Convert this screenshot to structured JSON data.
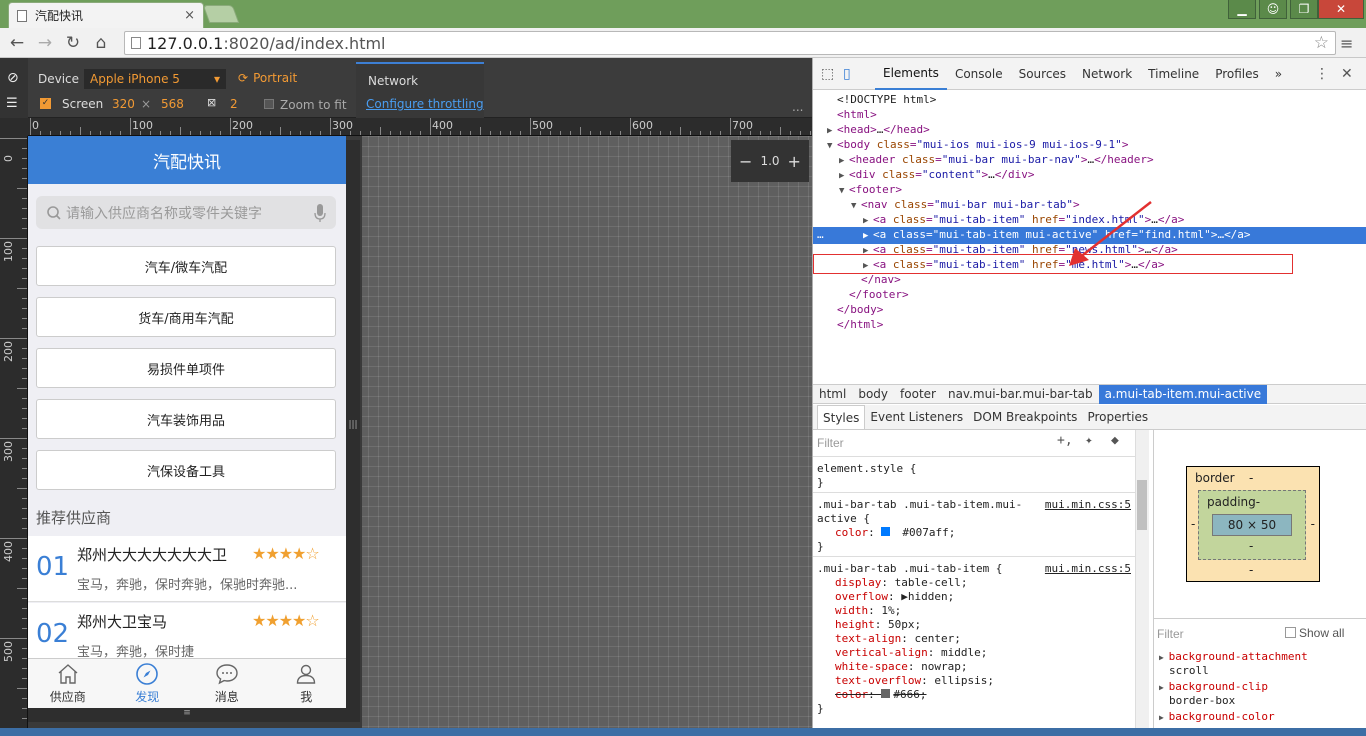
{
  "browser": {
    "tab_title": "汽配快讯",
    "url_host": "127.0.0.1",
    "url_rest": ":8020/ad/index.html"
  },
  "device_bar": {
    "device_label": "Device",
    "device_value": "Apple iPhone 5",
    "orientation": "Portrait",
    "screen_label": "Screen",
    "width": "320",
    "times": "×",
    "height": "568",
    "dpr": "2",
    "zoom_to_fit": "Zoom to fit",
    "network_label": "Network",
    "throttling": "Configure throttling",
    "more": "..."
  },
  "zoom": {
    "minus": "−",
    "value": "1.0",
    "plus": "+"
  },
  "ruler": {
    "h_labels": [
      "0",
      "100",
      "200",
      "300",
      "400",
      "500",
      "600",
      "700"
    ],
    "v_labels": [
      "0",
      "100",
      "200",
      "300",
      "400",
      "500"
    ]
  },
  "app": {
    "title": "汽配快讯",
    "search_placeholder": "请输入供应商名称或零件关键字",
    "categories": [
      "汽车/微车汽配",
      "货车/商用车汽配",
      "易损件单项件",
      "汽车装饰用品",
      "汽保设备工具"
    ],
    "recommend_title": "推荐供应商",
    "suppliers": [
      {
        "num": "01",
        "name": "郑州大大大大大大大卫",
        "stars": "★★★★☆",
        "desc": "宝马，奔驰，保时奔驰，保驰时奔驰..."
      },
      {
        "num": "02",
        "name": "郑州大卫宝马",
        "stars": "★★★★☆",
        "desc": "宝马，奔驰，保时捷"
      }
    ],
    "tabs": [
      {
        "label": "供应商",
        "icon": "home-icon"
      },
      {
        "label": "发现",
        "icon": "compass-icon"
      },
      {
        "label": "消息",
        "icon": "chat-icon"
      },
      {
        "label": "我",
        "icon": "user-icon"
      }
    ]
  },
  "devtools": {
    "tabs": [
      "Elements",
      "Console",
      "Sources",
      "Network",
      "Timeline",
      "Profiles",
      "»"
    ],
    "dom_lines": [
      {
        "indent": 0,
        "tw": "",
        "parts": [
          [
            "tx",
            "<!DOCTYPE html>"
          ]
        ]
      },
      {
        "indent": 0,
        "tw": "",
        "parts": [
          [
            "tg",
            "<html>"
          ]
        ]
      },
      {
        "indent": 0,
        "tw": "▶",
        "parts": [
          [
            "tg",
            "<head>"
          ],
          [
            "tx",
            "…"
          ],
          [
            "tg",
            "</head>"
          ]
        ]
      },
      {
        "indent": 0,
        "tw": "▼",
        "parts": [
          [
            "tg",
            "<body "
          ],
          [
            "at",
            "class"
          ],
          [
            "tg",
            "="
          ],
          [
            "av",
            "\"mui-ios mui-ios-9 mui-ios-9-1\""
          ],
          [
            "tg",
            ">"
          ]
        ]
      },
      {
        "indent": 1,
        "tw": "▶",
        "parts": [
          [
            "tg",
            "<header "
          ],
          [
            "at",
            "class"
          ],
          [
            "tg",
            "="
          ],
          [
            "av",
            "\"mui-bar mui-bar-nav\""
          ],
          [
            "tg",
            ">"
          ],
          [
            "tx",
            "…"
          ],
          [
            "tg",
            "</header>"
          ]
        ]
      },
      {
        "indent": 1,
        "tw": "▶",
        "parts": [
          [
            "tg",
            "<div "
          ],
          [
            "at",
            "class"
          ],
          [
            "tg",
            "="
          ],
          [
            "av",
            "\"content\""
          ],
          [
            "tg",
            ">"
          ],
          [
            "tx",
            "…"
          ],
          [
            "tg",
            "</div>"
          ]
        ]
      },
      {
        "indent": 1,
        "tw": "▼",
        "parts": [
          [
            "tg",
            "<footer>"
          ]
        ]
      },
      {
        "indent": 2,
        "tw": "▼",
        "parts": [
          [
            "tg",
            "<nav "
          ],
          [
            "at",
            "class"
          ],
          [
            "tg",
            "="
          ],
          [
            "av",
            "\"mui-bar mui-bar-tab\""
          ],
          [
            "tg",
            ">"
          ]
        ]
      },
      {
        "indent": 3,
        "tw": "▶",
        "parts": [
          [
            "tg",
            "<a "
          ],
          [
            "at",
            "class"
          ],
          [
            "tg",
            "="
          ],
          [
            "av",
            "\"mui-tab-item\""
          ],
          [
            "tg",
            " "
          ],
          [
            "at",
            "href"
          ],
          [
            "tg",
            "="
          ],
          [
            "av",
            "\"index.html\""
          ],
          [
            "tg",
            ">"
          ],
          [
            "tx",
            "…"
          ],
          [
            "tg",
            "</a>"
          ]
        ]
      },
      {
        "indent": 3,
        "tw": "▶",
        "sel": true,
        "parts": [
          [
            "tg",
            "<a "
          ],
          [
            "at",
            "class"
          ],
          [
            "tg",
            "="
          ],
          [
            "av",
            "\"mui-tab-item mui-active\""
          ],
          [
            "tg",
            " "
          ],
          [
            "at",
            "href"
          ],
          [
            "tg",
            "="
          ],
          [
            "av",
            "\"find.html\""
          ],
          [
            "tg",
            ">"
          ],
          [
            "tx",
            "…"
          ],
          [
            "tg",
            "</a>"
          ]
        ]
      },
      {
        "indent": 3,
        "tw": "▶",
        "parts": [
          [
            "tg",
            "<a "
          ],
          [
            "at",
            "class"
          ],
          [
            "tg",
            "="
          ],
          [
            "av",
            "\"mui-tab-item\""
          ],
          [
            "tg",
            " "
          ],
          [
            "at",
            "href"
          ],
          [
            "tg",
            "="
          ],
          [
            "av",
            "\"news.html\""
          ],
          [
            "tg",
            ">"
          ],
          [
            "tx",
            "…"
          ],
          [
            "tg",
            "</a>"
          ]
        ]
      },
      {
        "indent": 3,
        "tw": "▶",
        "parts": [
          [
            "tg",
            "<a "
          ],
          [
            "at",
            "class"
          ],
          [
            "tg",
            "="
          ],
          [
            "av",
            "\"mui-tab-item\""
          ],
          [
            "tg",
            " "
          ],
          [
            "at",
            "href"
          ],
          [
            "tg",
            "="
          ],
          [
            "av",
            "\"me.html\""
          ],
          [
            "tg",
            ">"
          ],
          [
            "tx",
            "…"
          ],
          [
            "tg",
            "</a>"
          ]
        ]
      },
      {
        "indent": 2,
        "tw": "",
        "parts": [
          [
            "tg",
            "</nav>"
          ]
        ]
      },
      {
        "indent": 1,
        "tw": "",
        "parts": [
          [
            "tg",
            "</footer>"
          ]
        ]
      },
      {
        "indent": 0,
        "tw": "",
        "parts": [
          [
            "tg",
            "</body>"
          ]
        ]
      },
      {
        "indent": 0,
        "tw": "",
        "parts": [
          [
            "tg",
            "</html>"
          ]
        ]
      }
    ],
    "breadcrumbs": [
      "html",
      "body",
      "footer",
      "nav.mui-bar.mui-bar-tab",
      "a.mui-tab-item.mui-active"
    ],
    "subtabs": [
      "Styles",
      "Event Listeners",
      "DOM Breakpoints",
      "Properties"
    ],
    "filter": "Filter",
    "styles": {
      "element_style": "element.style {",
      "close": "}",
      "rule1_sel_a": ".mui-bar-tab .mui-tab-item.mui-",
      "rule1_sel_b": "active {",
      "rule1_src": "mui.min.css:5",
      "rule1_props": [
        {
          "name": "color",
          "value": "#007aff;"
        }
      ],
      "rule2_sel": ".mui-bar-tab .mui-tab-item {",
      "rule2_src": "mui.min.css:5",
      "rule2_props": [
        {
          "name": "display",
          "value": "table-cell;"
        },
        {
          "name": "overflow",
          "value": "▶hidden;"
        },
        {
          "name": "width",
          "value": "1%;"
        },
        {
          "name": "height",
          "value": "50px;"
        },
        {
          "name": "text-align",
          "value": "center;"
        },
        {
          "name": "vertical-align",
          "value": "middle;"
        },
        {
          "name": "white-space",
          "value": "nowrap;"
        },
        {
          "name": "text-overflow",
          "value": "ellipsis;"
        },
        {
          "name": "color",
          "value": "#666;"
        }
      ],
      "swatch_active": "#007aff",
      "swatch_grey": "#666666"
    },
    "box_model": {
      "border": "border",
      "padding": "padding-",
      "dash": "-",
      "content": "80 × 50"
    },
    "computed": {
      "filter": "Filter",
      "show_all": "Show all",
      "items": [
        {
          "name": "background-attachment",
          "value": "scroll"
        },
        {
          "name": "background-clip",
          "value": "border-box"
        },
        {
          "name": "background-color",
          "value": ""
        }
      ]
    }
  },
  "colors": {
    "accent": "#3a7fd5",
    "chrome_green": "#6f9e5b",
    "star": "#f0a030"
  }
}
